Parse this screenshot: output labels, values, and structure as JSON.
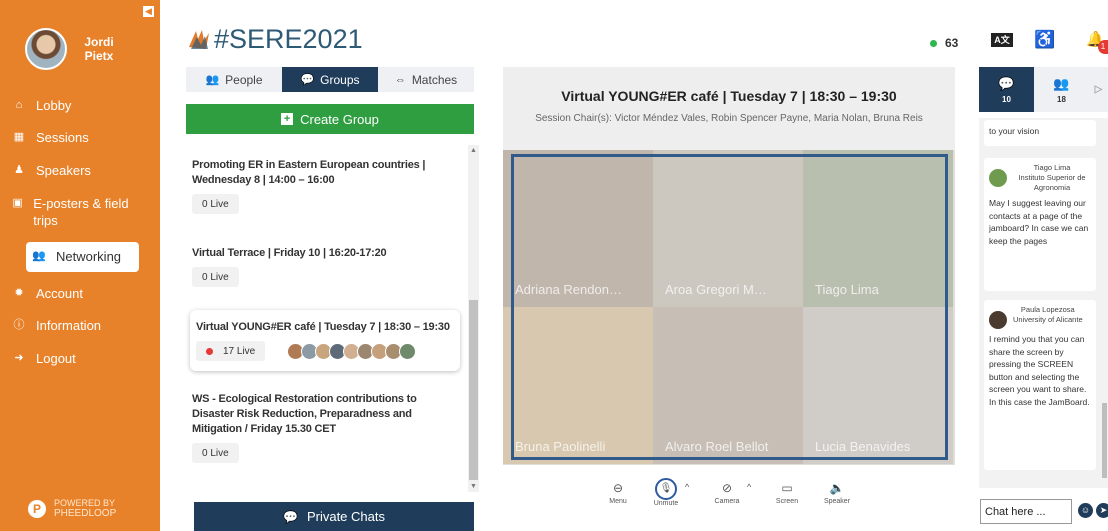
{
  "user": {
    "name": "Jordi Pietx"
  },
  "sidebar": {
    "items": [
      {
        "label": "Lobby",
        "icon": "home-icon"
      },
      {
        "label": "Sessions",
        "icon": "calendar-icon"
      },
      {
        "label": "Speakers",
        "icon": "speaker-icon"
      },
      {
        "label": "E-posters & field trips",
        "icon": "poster-icon"
      },
      {
        "label": "Networking",
        "icon": "users-icon",
        "active": true
      },
      {
        "label": "Account",
        "icon": "gear-icon"
      },
      {
        "label": "Information",
        "icon": "info-icon"
      },
      {
        "label": "Logout",
        "icon": "logout-icon"
      }
    ],
    "powered_by": "POWERED BY",
    "powered_brand": "PHEEDLOOP"
  },
  "header": {
    "brand": "#SERE2021",
    "online_count": "63",
    "notification_count": "1"
  },
  "groups_panel": {
    "tabs": [
      {
        "label": "People"
      },
      {
        "label": "Groups"
      },
      {
        "label": "Matches"
      }
    ],
    "active_tab": "Groups",
    "create_label": "Create Group",
    "groups": [
      {
        "title": "Promoting ER in Eastern European countries | Wednesday 8 | 14:00 – 16:00",
        "live": "0 Live"
      },
      {
        "title": "Virtual Terrace | Friday 10 | 16:20-17:20",
        "live": "0 Live"
      },
      {
        "title": "Virtual YOUNG#ER café | Tuesday 7 | 18:30 – 19:30",
        "live": "17 Live",
        "active": true
      },
      {
        "title": "WS - Ecological Restoration contributions to Disaster Risk Reduction, Preparadness and Mitigation / Friday 15.30 CET",
        "live": "0 Live"
      }
    ],
    "private_chats_label": "Private Chats"
  },
  "session": {
    "title": "Virtual YOUNG#ER café | Tuesday 7 | 18:30 – 19:30",
    "chairs": "Session Chair(s): Victor Méndez Vales, Robin Spencer Payne, Maria Nolan, Bruna Reis",
    "participants": [
      "Adriana Rendon…",
      "Aroa Gregori M…",
      "Tiago Lima",
      "Bruna Paolinelli",
      "Alvaro Roel Bellot",
      "Lucia Benavides"
    ],
    "controls": [
      {
        "label": "Menu",
        "icon": "menu-icon"
      },
      {
        "label": "Unmute",
        "icon": "mic-off-icon"
      },
      {
        "label": "Camera",
        "icon": "camera-off-icon"
      },
      {
        "label": "Screen",
        "icon": "screen-icon"
      },
      {
        "label": "Speaker",
        "icon": "speaker-volume-icon"
      }
    ]
  },
  "chat": {
    "tabs": [
      {
        "count": "10",
        "icon": "chat-bubble-icon"
      },
      {
        "count": "18",
        "icon": "users-icon"
      }
    ],
    "partial_message": "to your vision",
    "messages": [
      {
        "author": "Tiago Lima",
        "affiliation": "Instituto Superior de Agronomia",
        "text": "May I suggest leaving our contacts at a page of the jamboard? In case we can keep the pages"
      },
      {
        "author": "Paula Lopezosa",
        "affiliation": "University of Alicante",
        "text": "I remind you that you can share the screen by pressing the SCREEN button and selecting the screen you want to share. In this case the JamBoard."
      }
    ],
    "input_value": "Chat here ..."
  }
}
